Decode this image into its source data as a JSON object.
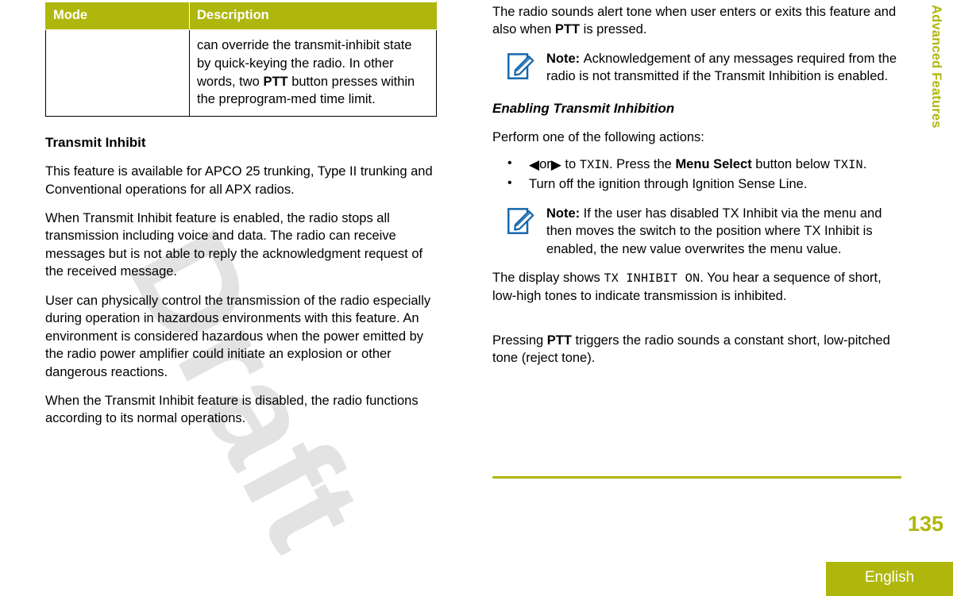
{
  "document": {
    "page_number": "135",
    "language": "English",
    "side_tab": "Advanced Features",
    "watermark": "Draft",
    "accent_color": "#afb70d",
    "note_icon_color": "#1468ac"
  },
  "table": {
    "headers": {
      "mode": "Mode",
      "description": "Description"
    },
    "rows": [
      {
        "mode": "",
        "description_pre": "can override the transmit-inhibit state by quick-keying the radio. In other words, two ",
        "description_bold": "PTT",
        "description_post": " button presses within the preprogram-med time limit."
      }
    ]
  },
  "left_column": {
    "heading": "Transmit Inhibit",
    "paragraphs": [
      "This feature is available for APCO 25 trunking, Type II trunking and Conventional operations for all APX radios.",
      "When Transmit Inhibit feature is enabled, the radio stops all transmission including voice and data. The radio can receive messages but is not able to reply the acknowledgment request of the received message.",
      "User can physically control the transmission of the radio especially during operation in hazardous environments with this feature. An environment is considered hazardous when the power emitted by the radio power amplifier could initiate an explosion or other dangerous reactions.",
      "When the Transmit Inhibit feature is disabled, the radio functions according to its normal operations."
    ]
  },
  "right_column": {
    "intro": {
      "pre": "The radio sounds alert tone when user enters or exits this feature and also when ",
      "bold": "PTT",
      "post": " is pressed."
    },
    "note_1": {
      "title": "Note:",
      "text": "Acknowledgement of any messages required from the radio is not transmitted if the Transmit Inhibition is enabled."
    },
    "subheading": "Enabling Transmit Inhibition",
    "perform_line": "Perform one of the following actions:",
    "bullets": [
      {
        "left_arrow": "◀",
        "or_text": "or",
        "right_arrow": "▶",
        "to_text": " to ",
        "code_1": "TXIN",
        "mid_text": ". Press the ",
        "bold_text": "Menu Select",
        "post_text": " button below ",
        "code_2": "TXIN",
        "end_text": "."
      },
      {
        "text": "Turn off the ignition through Ignition Sense Line."
      }
    ],
    "note_2": {
      "title": "Note:",
      "text": "If the user has disabled TX Inhibit via the menu and then moves the switch to the position where TX Inhibit is enabled, the new value overwrites the menu value."
    },
    "display_paragraph": {
      "pre": "The display shows ",
      "code": "TX INHIBIT ON",
      "post": ". You hear a sequence of short, low-high tones to indicate transmission is inhibited."
    },
    "footer_paragraph": {
      "pre": "Pressing ",
      "bold": "PTT",
      "post": " triggers the radio sounds a constant short, low-pitched tone (reject tone)."
    }
  }
}
